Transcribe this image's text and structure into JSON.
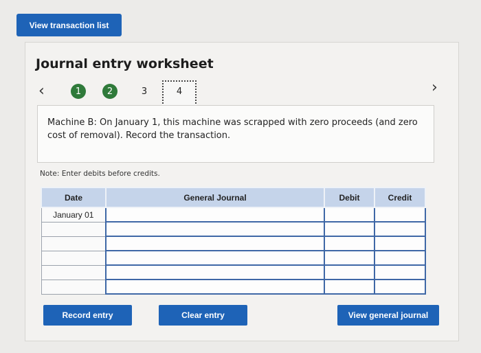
{
  "header": {
    "view_transactions_label": "View transaction list"
  },
  "worksheet": {
    "title": "Journal entry worksheet",
    "steps": [
      "1",
      "2",
      "3",
      "4"
    ],
    "description": "Machine B: On January 1, this machine was scrapped with zero proceeds (and zero cost of removal). Record the transaction.",
    "note": "Note: Enter debits before credits."
  },
  "table": {
    "columns": [
      "Date",
      "General Journal",
      "Debit",
      "Credit"
    ],
    "rows": [
      {
        "date": "January 01"
      },
      {
        "date": ""
      },
      {
        "date": ""
      },
      {
        "date": ""
      },
      {
        "date": ""
      },
      {
        "date": ""
      }
    ]
  },
  "buttons": {
    "record": "Record entry",
    "clear": "Clear entry",
    "view_journal": "View general journal"
  },
  "colors": {
    "accent": "#1e63b7",
    "step_done": "#2f7a3a",
    "header_fill": "#c5d4ea"
  }
}
